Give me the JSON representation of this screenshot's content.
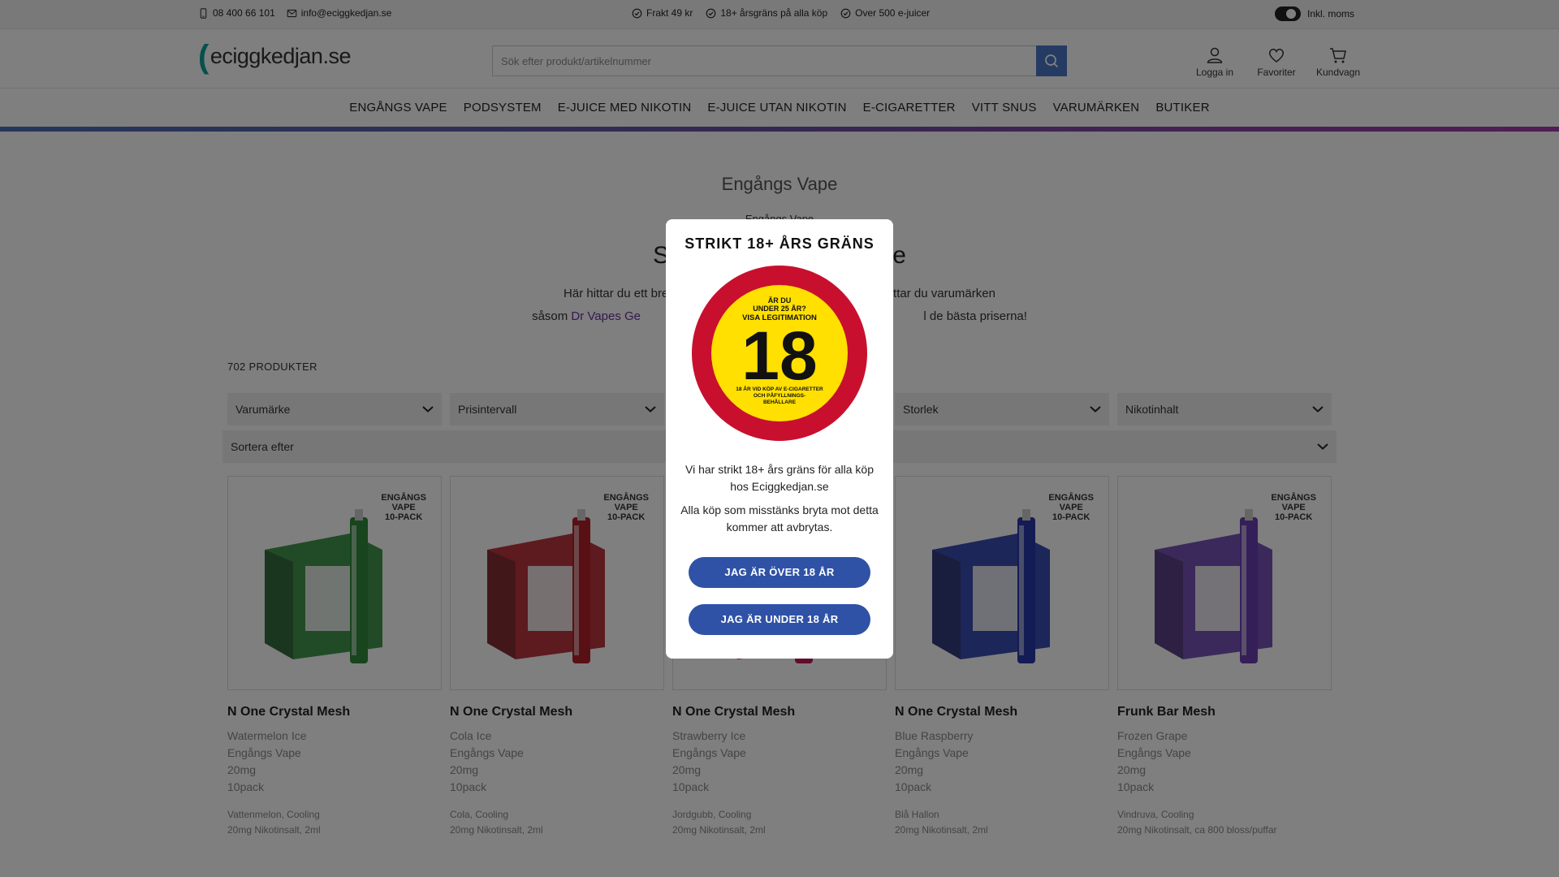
{
  "topbar": {
    "phone": "08 400 66 101",
    "email": "info@eciggkedjan.se",
    "usp": [
      "Frakt 49 kr",
      "18+ årsgräns på alla köp",
      "Over 500 e-juicer"
    ],
    "vat_label": "Inkl. moms"
  },
  "header": {
    "logo_text": "eciggkedjan.se",
    "search_placeholder": "Sök efter produkt/artikelnummer",
    "login_label": "Logga in",
    "favorites_label": "Favoriter",
    "cart_label": "Kundvagn"
  },
  "nav": {
    "items": [
      "ENGÅNGS VAPE",
      "PODSYSTEM",
      "E-JUICE MED NIKOTIN",
      "E-JUICE UTAN NIKOTIN",
      "E-CIGARETTER",
      "VITT SNUS",
      "VARUMÄRKEN",
      "BUTIKER"
    ]
  },
  "page": {
    "title": "Engångs Vape",
    "breadcrumb": "Engångs Vape",
    "heading": "Sto                          ape",
    "intro_line1": "Här hittar du ett brett utbud a                                   ker. Här hittar du varumärken",
    "intro_line2_pre": "såsom",
    "intro_link": "Dr Vapes Ge",
    "intro_line2_post": "l de bästa priserna!",
    "product_count": "702 PRODUKTER"
  },
  "filters": [
    "Varumärke",
    "Prisintervall",
    "",
    "Storlek",
    "Nikotinhalt"
  ],
  "sort_label": "Sortera efter",
  "products": [
    {
      "name": "N One Crystal Mesh",
      "flavor": "Watermelon Ice",
      "category": "Engångs Vape",
      "strength": "20mg",
      "pack": "10pack",
      "tags": "Vattenmelon, Cooling",
      "spec": "20mg Nikotinsalt, 2ml",
      "badge_l1": "ENGÅNGS",
      "badge_l2": "VAPE",
      "badge_l3": "10-PACK",
      "color": "#2e8b3a"
    },
    {
      "name": "N One Crystal Mesh",
      "flavor": "Cola Ice",
      "category": "Engångs Vape",
      "strength": "20mg",
      "pack": "10pack",
      "tags": "Cola, Cooling",
      "spec": "20mg Nikotinsalt, 2ml",
      "badge_l1": "ENGÅNGS",
      "badge_l2": "VAPE",
      "badge_l3": "10-PACK",
      "color": "#b3202a"
    },
    {
      "name": "N One Crystal Mesh",
      "flavor": "Strawberry Ice",
      "category": "Engångs Vape",
      "strength": "20mg",
      "pack": "10pack",
      "tags": "Jordgubb, Cooling",
      "spec": "20mg Nikotinsalt, 2ml",
      "badge_l1": "ENGÅNGS",
      "badge_l2": "VAPE",
      "badge_l3": "10-PACK",
      "color": "#c2185b"
    },
    {
      "name": "N One Crystal Mesh",
      "flavor": "Blue Raspberry",
      "category": "Engångs Vape",
      "strength": "20mg",
      "pack": "10pack",
      "tags": "Blå Hallon",
      "spec": "20mg Nikotinsalt, 2ml",
      "badge_l1": "ENGÅNGS",
      "badge_l2": "VAPE",
      "badge_l3": "10-PACK",
      "color": "#2638a8"
    },
    {
      "name": "Frunk Bar Mesh",
      "flavor": "Frozen Grape",
      "category": "Engångs Vape",
      "strength": "20mg",
      "pack": "10pack",
      "tags": "Vindruva, Cooling",
      "spec": "20mg Nikotinsalt, ca 800 bloss/puffar",
      "badge_l1": "ENGÅNGS",
      "badge_l2": "VAPE",
      "badge_l3": "10-PACK",
      "color": "#6a3fb0"
    }
  ],
  "modal": {
    "title": "STRIKT 18+ ÅRS GRÄNS",
    "seal_top_l1": "ÄR DU",
    "seal_top_l2": "UNDER 25 ÅR?",
    "seal_top_l3": "VISA LEGITIMATION",
    "seal_number": "18",
    "seal_bottom_l1": "18 ÅR VID KÖP AV E-CIGARETTER",
    "seal_bottom_l2": "OCH PÅFYLLNINGS-",
    "seal_bottom_l3": "BEHÅLLARE",
    "message1": "Vi har strikt 18+ års gräns för alla köp hos Eciggkedjan.se",
    "message2": "Alla köp som misstänks bryta mot detta kommer att avbrytas.",
    "over_button": "JAG ÄR ÖVER 18 ÅR",
    "under_button": "JAG ÄR UNDER 18 ÅR",
    "seal_outer_color": "#c8102e",
    "seal_inner_color": "#ffe000"
  }
}
